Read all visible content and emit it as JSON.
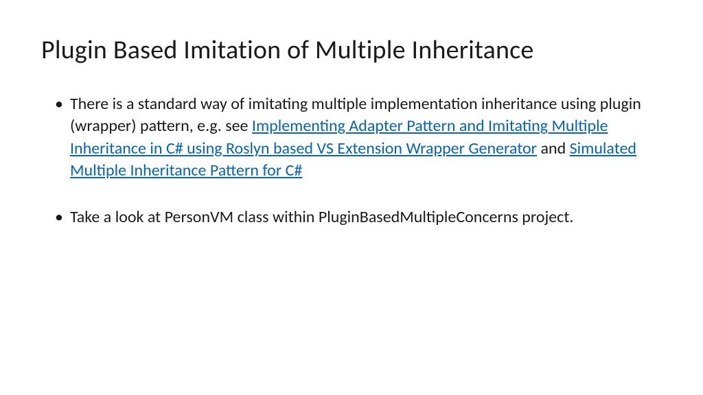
{
  "title": "Plugin Based Imitation of Multiple Inheritance",
  "bullets": [
    {
      "pre": "There is a standard way of imitating multiple implementation inheritance using plugin (wrapper) pattern, e.g. see ",
      "link1": "Implementing Adapter Pattern and Imitating Multiple Inheritance in C# using Roslyn based VS Extension Wrapper Generator",
      "mid": " and ",
      "link2": "Simulated Multiple Inheritance Pattern for C#",
      "post": ""
    },
    {
      "pre": "Take a look at PersonVM class within PluginBasedMultipleConcerns project.",
      "link1": "",
      "mid": "",
      "link2": "",
      "post": ""
    }
  ]
}
